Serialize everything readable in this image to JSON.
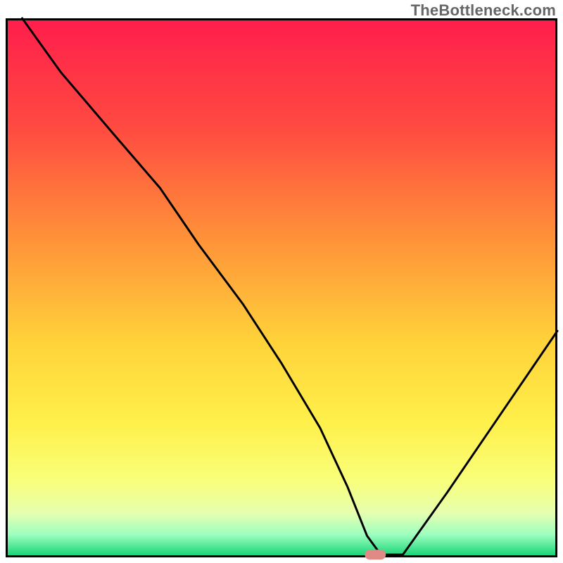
{
  "watermark": "TheBottleneck.com",
  "chart_data": {
    "type": "line",
    "title": "",
    "xlabel": "",
    "ylabel": "",
    "xlim": [
      0,
      100
    ],
    "ylim": [
      0,
      100
    ],
    "grid": false,
    "legend": false,
    "series": [
      {
        "name": "bottleneck-curve",
        "x": [
          3,
          10,
          20,
          28,
          35,
          43,
          50,
          57,
          62,
          65.5,
          68,
          72,
          80,
          90,
          100
        ],
        "values": [
          100,
          90,
          78,
          68.5,
          58,
          47,
          36,
          24,
          13,
          4,
          0.5,
          0.5,
          12,
          27,
          42
        ]
      }
    ],
    "marker": {
      "x": 67,
      "y": 0.5,
      "color": "#e18a85"
    },
    "gradient_stops": [
      {
        "offset": 0,
        "color": "#ff1e4c"
      },
      {
        "offset": 20,
        "color": "#ff4a41"
      },
      {
        "offset": 40,
        "color": "#ff8f39"
      },
      {
        "offset": 60,
        "color": "#ffd23a"
      },
      {
        "offset": 75,
        "color": "#fff04a"
      },
      {
        "offset": 86,
        "color": "#f9ff7a"
      },
      {
        "offset": 92,
        "color": "#e6ffb0"
      },
      {
        "offset": 96,
        "color": "#9effc0"
      },
      {
        "offset": 100,
        "color": "#16d477"
      }
    ],
    "border_color": "#000000",
    "line_color": "#000000",
    "line_width": 3
  }
}
